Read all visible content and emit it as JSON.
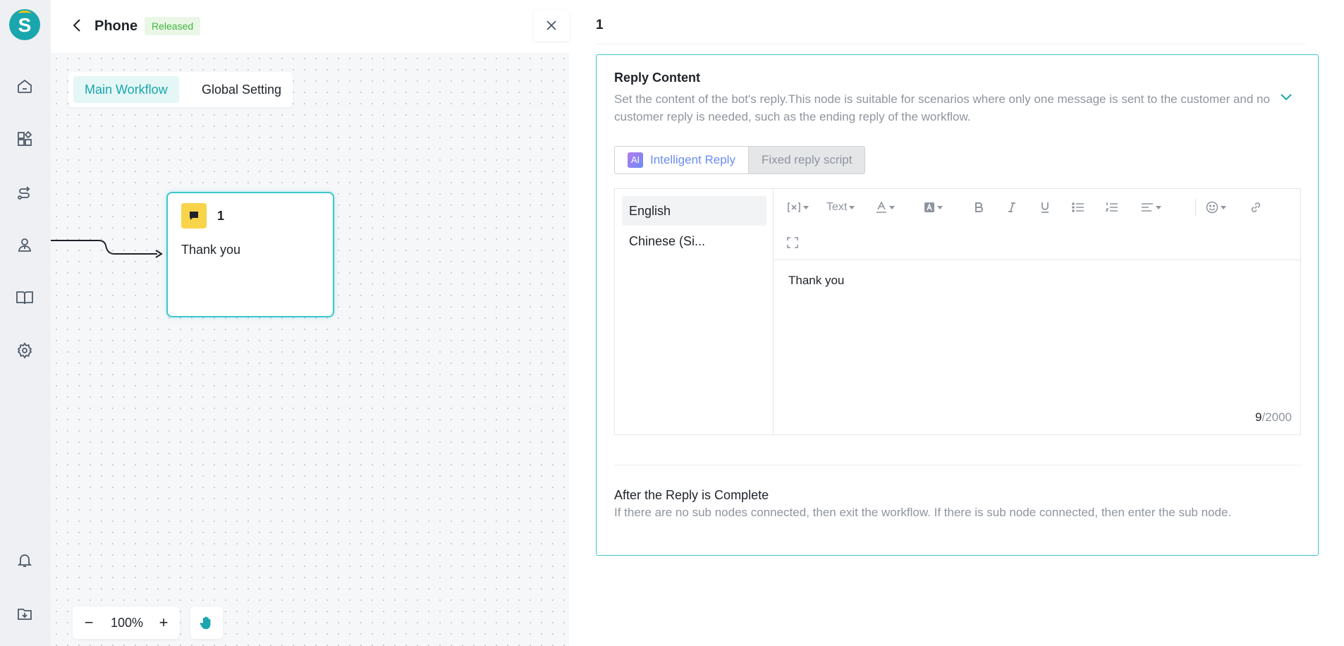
{
  "app": {
    "logo_letter": "S",
    "brand_color": "#1aa6ad"
  },
  "nav": {
    "items": [
      "home-icon",
      "apps-icon",
      "workflow-icon",
      "agent-icon",
      "book-icon",
      "settings-icon"
    ],
    "bottom": [
      "bell-icon",
      "download-icon"
    ]
  },
  "header": {
    "title": "Phone",
    "status": "Released"
  },
  "canvas": {
    "tabs": [
      {
        "label": "Main Workflow",
        "active": true
      },
      {
        "label": "Global Setting",
        "active": false
      }
    ],
    "node": {
      "title": "1",
      "text": "Thank you",
      "icon": "message-icon"
    },
    "zoom": {
      "minus": "−",
      "value": "100%",
      "plus": "+"
    }
  },
  "panel": {
    "title": "1",
    "section": {
      "heading": "Reply Content",
      "description": "Set the content of the bot's reply.This node is suitable for scenarios where only one message is sent to the customer and no customer reply is needed, such as the ending reply of the workflow."
    },
    "reply_tabs": {
      "ai_badge": "AI",
      "ai_label": "Intelligent Reply",
      "fixed_label": "Fixed reply script"
    },
    "languages": [
      "English",
      "Chinese (Si..."
    ],
    "toolbar": {
      "text_style": "Text"
    },
    "content": "Thank you",
    "counter": {
      "current": "9",
      "max": "/2000"
    },
    "after": {
      "heading": "After the Reply is Complete",
      "description": "If there are no sub nodes connected, then exit the workflow. If there is sub node connected, then enter the sub node."
    }
  }
}
